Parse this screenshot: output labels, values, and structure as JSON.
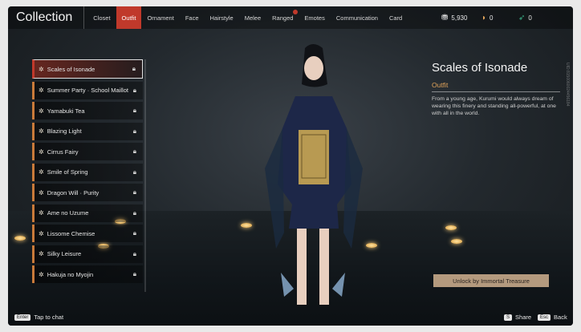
{
  "header": {
    "title": "Collection",
    "tabs": [
      {
        "label": "Closet",
        "active": false,
        "badge": false
      },
      {
        "label": "Outfit",
        "active": true,
        "badge": false
      },
      {
        "label": "Ornament",
        "active": false,
        "badge": false
      },
      {
        "label": "Face",
        "active": false,
        "badge": false
      },
      {
        "label": "Hairstyle",
        "active": false,
        "badge": false
      },
      {
        "label": "Melee",
        "active": false,
        "badge": false
      },
      {
        "label": "Ranged",
        "active": false,
        "badge": true
      },
      {
        "label": "Emotes",
        "active": false,
        "badge": false
      },
      {
        "label": "Communication",
        "active": false,
        "badge": false
      },
      {
        "label": "Card",
        "active": false,
        "badge": false
      }
    ],
    "currencies": [
      {
        "icon": "coin-stack-icon",
        "value": "5,930"
      },
      {
        "icon": "pouch-icon",
        "value": "0"
      },
      {
        "icon": "feather-icon",
        "value": "0"
      }
    ]
  },
  "outfits": [
    {
      "name": "Scales of Isonade",
      "selected": true,
      "locked": true
    },
    {
      "name": "Summer Party · School Maillot",
      "selected": false,
      "locked": true
    },
    {
      "name": "Yamabuki Tea",
      "selected": false,
      "locked": true
    },
    {
      "name": "Blazing Light",
      "selected": false,
      "locked": true
    },
    {
      "name": "Cirrus Fairy",
      "selected": false,
      "locked": true
    },
    {
      "name": "Smile of Spring",
      "selected": false,
      "locked": true
    },
    {
      "name": "Dragon Will · Purity",
      "selected": false,
      "locked": true
    },
    {
      "name": "Ame no Uzume",
      "selected": false,
      "locked": true
    },
    {
      "name": "Lissome Chemise",
      "selected": false,
      "locked": true
    },
    {
      "name": "Silky Leisure",
      "selected": false,
      "locked": true
    },
    {
      "name": "Hakuja no Myojin",
      "selected": false,
      "locked": true
    }
  ],
  "detail": {
    "name": "Scales of Isonade",
    "category": "Outfit",
    "description": "From a young age, Kurumi would always dream of wearing this finery and standing all-powerful, at one with all in the world.",
    "unlock_label": "Unlock by Immortal Treasure",
    "side_id": "UID:8150060024456184"
  },
  "footer": {
    "chat_key": "Enter",
    "chat_label": "Tap to chat",
    "share_key": "S",
    "share_label": "Share",
    "back_key": "Esc",
    "back_label": "Back"
  },
  "colors": {
    "accent": "#c0392b",
    "item_accent": "#c97a3a",
    "category": "#e0a35a",
    "unlock_bg": "#b49a7e"
  }
}
